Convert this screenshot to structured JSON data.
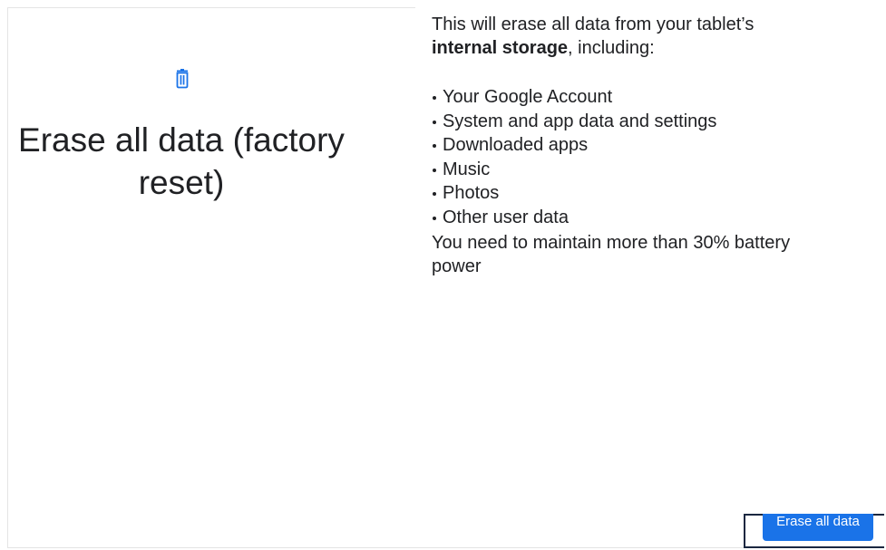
{
  "left_pane": {
    "icon": "trash-icon",
    "icon_color": "#1a73e8",
    "title": "Erase all data (factory reset)"
  },
  "right_pane": {
    "intro_prefix": "This will erase all data from your tablet’s",
    "intro_bold": "internal storage",
    "intro_suffix": ", including:",
    "items": [
      "Your Google Account",
      "System and app data and settings",
      "Downloaded apps",
      "Music",
      "Photos",
      "Other user data"
    ],
    "battery_note": "You need to maintain more than 30% battery power"
  },
  "actions": {
    "erase_button_label": "Erase all data",
    "accent_color": "#1a73e8"
  }
}
